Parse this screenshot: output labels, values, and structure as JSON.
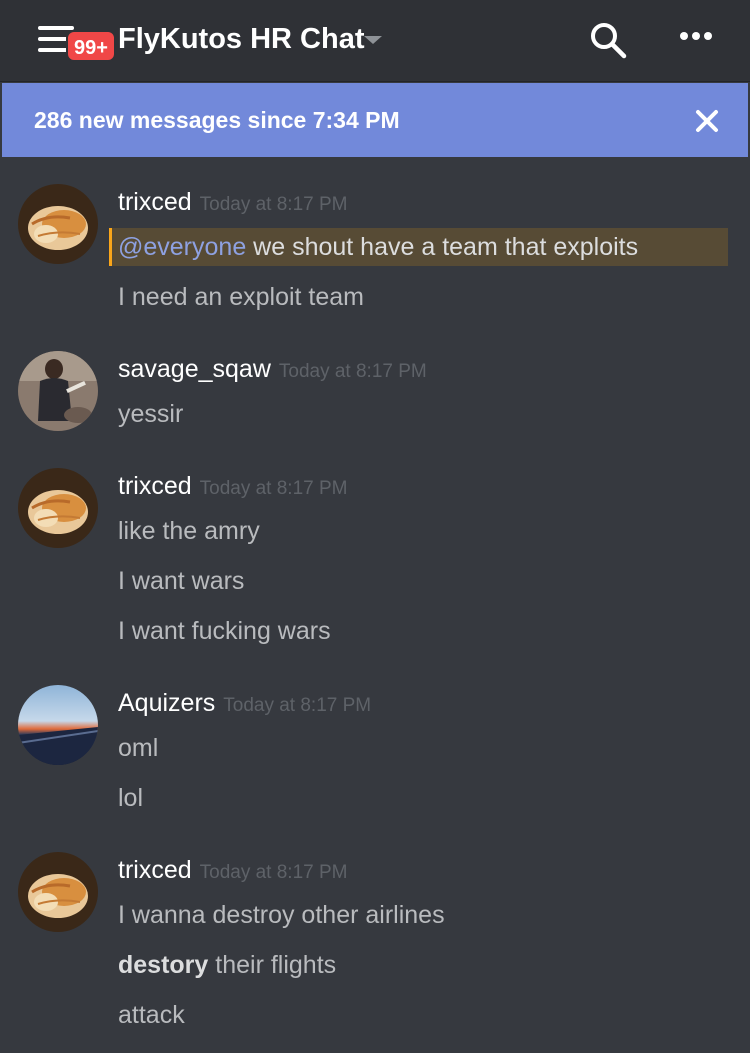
{
  "header": {
    "menu_icon": "hamburger-menu-icon",
    "unread_badge": "99+",
    "channel_name": "FlyKutos HR Chat",
    "search_icon": "search-icon",
    "more_icon": "more-horizontal-icon"
  },
  "banner": {
    "text": "286 new messages since 7:34 PM",
    "close_icon": "close-icon"
  },
  "colors": {
    "background": "#36393f",
    "header": "#2f3136",
    "banner": "#7289da",
    "badge": "#f04747",
    "mention_bg": "#574b35",
    "mention_border": "#faa61a",
    "mention_text": "#8ea1e1",
    "timestamp": "#5e6268",
    "message_text": "#b9bbbe"
  },
  "messages": [
    {
      "author": "trixced",
      "timestamp": "Today at 8:17 PM",
      "avatar": "cat-avatar",
      "lines": [
        {
          "mention": "@everyone",
          "text": " we shout have a team that exploits"
        },
        {
          "text": "I need an exploit team"
        }
      ]
    },
    {
      "author": "savage_sqaw",
      "timestamp": "Today at 8:17 PM",
      "avatar": "person-photo-avatar",
      "lines": [
        {
          "text": "yessir"
        }
      ]
    },
    {
      "author": "trixced",
      "timestamp": "Today at 8:17 PM",
      "avatar": "cat-avatar",
      "lines": [
        {
          "text": "like the amry"
        },
        {
          "text": "I want wars"
        },
        {
          "text": "I want fucking wars"
        }
      ]
    },
    {
      "author": "Aquizers",
      "timestamp": "Today at 8:17 PM",
      "avatar": "sky-photo-avatar",
      "lines": [
        {
          "text": "oml"
        },
        {
          "text": "lol"
        }
      ]
    },
    {
      "author": "trixced",
      "timestamp": "Today at 8:17 PM",
      "avatar": "cat-avatar",
      "lines": [
        {
          "text": "I wanna destroy other airlines"
        },
        {
          "bold": "destory",
          "text": " their flights"
        },
        {
          "text": "attack"
        }
      ]
    }
  ]
}
